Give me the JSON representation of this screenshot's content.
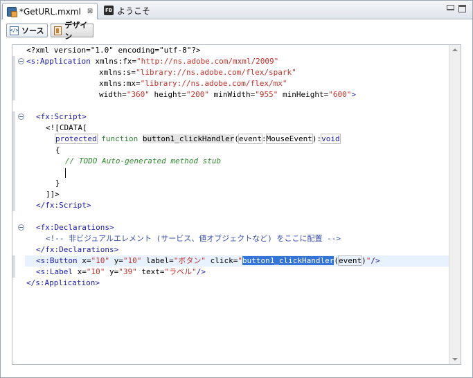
{
  "tabs": [
    {
      "label": "*GetURL.mxml",
      "close": "⊠"
    },
    {
      "label": "ようこそ",
      "icon_text": "FB"
    }
  ],
  "toolbar": {
    "source_label": "ソース",
    "design_label": "デザイン"
  },
  "code": {
    "l1": "<?xml version=\"1.0\" encoding=\"utf-8\"?>",
    "l2_tag": "<s:Application",
    "l2_attr": " xmlns:fx=",
    "l2_val": "\"http://ns.adobe.com/mxml/2009\"",
    "l3_attr": "xmlns:s=",
    "l3_val": "\"library://ns.adobe.com/flex/spark\"",
    "l4_attr": "xmlns:mx=",
    "l4_val": "\"library://ns.adobe.com/flex/mx\"",
    "l5_a1": "width=",
    "l5_v1": "\"360\"",
    "l5_a2": " height=",
    "l5_v2": "\"200\"",
    "l5_a3": " minWidth=",
    "l5_v3": "\"955\"",
    "l5_a4": " minHeight=",
    "l5_v4": "\"600\"",
    "l5_end": ">",
    "l7": "<fx:Script>",
    "l8": "<![CDATA[",
    "l9_kw1": "protected",
    "l9_kw2": "function",
    "l9_fn": "button1_clickHandler",
    "l9_p1": "(",
    "l9_arg": "event",
    "l9_colon": ":",
    "l9_type": "MouseEvent",
    "l9_p2": "):",
    "l9_ret": "void",
    "l10": "{",
    "l11": "// TODO Auto-generated method stub",
    "l13": "}",
    "l14": "]]>",
    "l15": "</fx:Script>",
    "l17": "<fx:Declarations>",
    "l18": "<!-- 非ビジュアルエレメント (サービス、値オブジェクトなど) をここに配置 -->",
    "l19": "</fx:Declarations>",
    "l20_tag": "<s:Button",
    "l20_a1": " x=",
    "l20_v1": "\"10\"",
    "l20_a2": " y=",
    "l20_v2": "\"10\"",
    "l20_a3": " label=",
    "l20_v3": "\"ボタン\"",
    "l20_a4": " click=",
    "l20_q1": "\"",
    "l20_sel": "button1_clickHandler",
    "l20_p1": "(",
    "l20_arg": "event",
    "l20_p2": ")",
    "l20_q2": "\"",
    "l20_end": "/>",
    "l21_tag": "<s:Label",
    "l21_a1": " x=",
    "l21_v1": "\"10\"",
    "l21_a2": " y=",
    "l21_v2": "\"39\"",
    "l21_a3": " text=",
    "l21_v3": "\"ラベル\"",
    "l21_end": "/>",
    "l22": "</s:Application>"
  }
}
